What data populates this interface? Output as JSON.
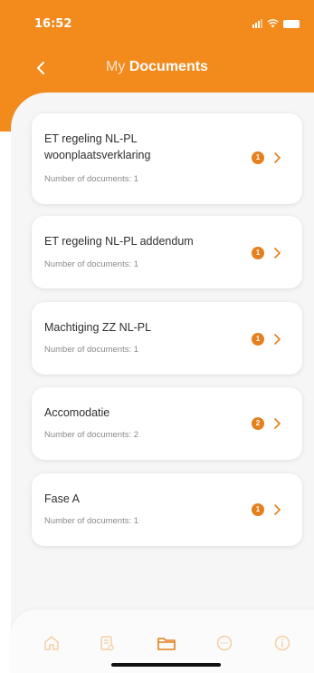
{
  "status_bar": {
    "time": "16:52"
  },
  "header": {
    "title_prefix": "My ",
    "title_main": "Documents"
  },
  "colors": {
    "accent": "#f28a1c",
    "badge": "#e4801e",
    "tab_inactive": "#f5cfa4"
  },
  "documents": [
    {
      "title": "ET regeling NL-PL woonplaatsverklaring",
      "subtitle": "Number of documents: 1",
      "count": "1"
    },
    {
      "title": "ET regeling NL-PL addendum",
      "subtitle": "Number of documents: 1",
      "count": "1"
    },
    {
      "title": "Machtiging ZZ NL-PL",
      "subtitle": "Number of documents: 1",
      "count": "1"
    },
    {
      "title": "Accomodatie",
      "subtitle": "Number of documents: 2",
      "count": "2"
    },
    {
      "title": "Fase A",
      "subtitle": "Number of documents: 1",
      "count": "1"
    }
  ],
  "tabbar": {
    "items": [
      {
        "icon": "home-icon",
        "active": false
      },
      {
        "icon": "documents-list-icon",
        "active": false
      },
      {
        "icon": "folder-icon",
        "active": true
      },
      {
        "icon": "chat-icon",
        "active": false
      },
      {
        "icon": "info-icon",
        "active": false
      }
    ]
  }
}
